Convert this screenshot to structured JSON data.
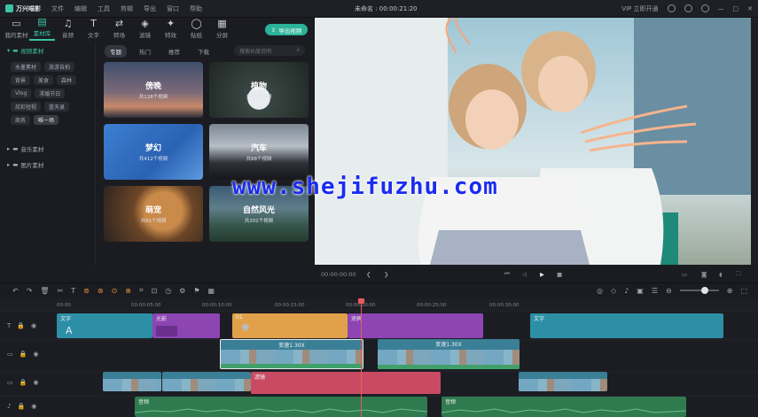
{
  "app": {
    "name": "万兴喵影",
    "title_center": "未命名 : 00:00:21:20",
    "vip_label": "立即开通"
  },
  "menu": [
    "文件",
    "编辑",
    "工具",
    "剪辑",
    "导出",
    "窗口",
    "帮助"
  ],
  "toolbar": [
    {
      "label": "我的素材",
      "icon": "folder-icon"
    },
    {
      "label": "素材库",
      "icon": "library-icon"
    },
    {
      "label": "音频",
      "icon": "music-icon"
    },
    {
      "label": "文字",
      "icon": "text-icon"
    },
    {
      "label": "转场",
      "icon": "transition-icon"
    },
    {
      "label": "滤镜",
      "icon": "filter-icon"
    },
    {
      "label": "特效",
      "icon": "effects-icon"
    },
    {
      "label": "贴纸",
      "icon": "sticker-icon"
    },
    {
      "label": "分屏",
      "icon": "split-icon"
    }
  ],
  "export_label": "导出视频",
  "sidebar": {
    "section1": "视频素材",
    "tags": [
      "水墨素材",
      "旅游自拍",
      "背景",
      "美食",
      "森林",
      "Vlog",
      "求婚节日",
      "炫彩短视",
      "蓝天录",
      "商务",
      "唯一场"
    ],
    "section2": "音乐素材",
    "section3": "图片素材"
  },
  "library": {
    "filters": [
      "专题",
      "热门",
      "推荐",
      "下载"
    ],
    "search_placeholder": "搜索长度说明",
    "cards": [
      {
        "title": "傍晚",
        "sub": "共128个视频"
      },
      {
        "title": "植物",
        "sub": "共98个视频"
      },
      {
        "title": "梦幻",
        "sub": "共412个视频"
      },
      {
        "title": "汽车",
        "sub": "共88个视频"
      },
      {
        "title": "萌宠",
        "sub": "共81个视频"
      },
      {
        "title": "自然风光",
        "sub": "共201个视频"
      }
    ]
  },
  "preview": {
    "timecode": "00:00:00:00"
  },
  "watermark": "www.shejifuzhu.com",
  "ruler_ticks": [
    "00:00",
    "00:00:05:00",
    "00:00:10:00",
    "00:00:15:00",
    "00:00:20:00",
    "00:00:25:00",
    "00:00:30:00"
  ],
  "clips": {
    "text1": "文字",
    "light": "光影",
    "orange": "01",
    "mosaic": "涂鸦",
    "text2": "文字",
    "video1": "变速1.30X",
    "video2": "变速1.30X",
    "pink": "滤镜",
    "audio1": "音频",
    "audio2": "音频"
  },
  "colors": {
    "accent": "#39c4a6",
    "text_clip": "#2d8fa6",
    "purple_clip": "#8c45b3",
    "orange_clip": "#e0a14a",
    "pink_clip": "#c84b63",
    "audio_clip": "#2f7a4f"
  }
}
